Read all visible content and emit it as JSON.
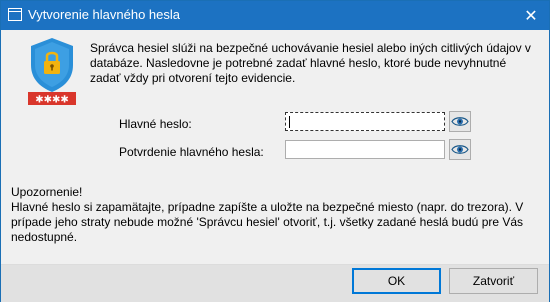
{
  "window": {
    "title": "Vytvorenie hlavného hesla"
  },
  "intro": {
    "text": "Správca hesiel slúži na bezpečné uchovávanie hesiel alebo iných citlivých údajov v databáze. Nasledovne je potrebné zadať hlavné heslo, ktoré bude nevyhnutné zadať vždy pri otvorení tejto evidencie."
  },
  "form": {
    "password_label": "Hlavné heslo:",
    "password_value": "",
    "confirm_label": "Potvrdenie hlavného hesla:",
    "confirm_value": ""
  },
  "warning": {
    "title": "Upozornenie!",
    "text": "Hlavné heslo si zapamätajte, prípadne zapíšte a uložte na bezpečné miesto (napr. do trezora). V prípade jeho straty nebude možné 'Správcu hesiel' otvoriť, t.j. všetky zadané heslá budú pre Vás nedostupné."
  },
  "buttons": {
    "ok": "OK",
    "close": "Zatvoriť"
  },
  "colors": {
    "titlebar": "#1c72c2",
    "shield": "#2a8fd8",
    "lock": "#f2b30f",
    "password_badge": "#d9362b"
  },
  "icons": {
    "title": "window-icon",
    "logo": "shield-lock-icon",
    "eye": "eye-icon",
    "close": "close-icon"
  }
}
